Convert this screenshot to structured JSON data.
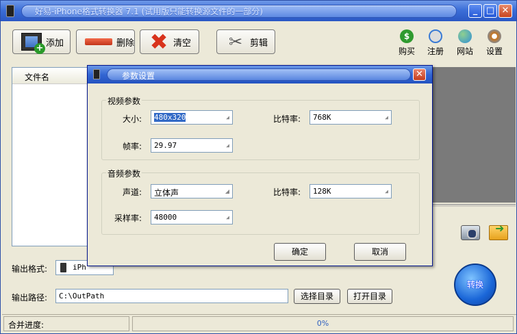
{
  "window": {
    "title": "好易-iPhone格式转换器 7.1 (试用版只能转换源文件的一部分)",
    "min": "_",
    "max": "□",
    "close": "✕"
  },
  "toolbar": {
    "add_label": "添加",
    "delete_label": "删除",
    "clear_label": "清空",
    "cut_label": "剪辑"
  },
  "right_tools": [
    {
      "label": "购买",
      "icon": "dollar-icon",
      "color": "#2f9a2f"
    },
    {
      "label": "注册",
      "icon": "lock-icon",
      "color": "#3a7bd5"
    },
    {
      "label": "网站",
      "icon": "globe-icon",
      "color": "#2f8fd8"
    },
    {
      "label": "设置",
      "icon": "gear-icon",
      "color": "#c8741e"
    }
  ],
  "filelist": {
    "header": "文件名"
  },
  "output": {
    "format_label": "输出格式:",
    "format_value": "iPh",
    "path_label": "输出路径:",
    "path_value": "C:\\OutPath",
    "choose_dir": "选择目录",
    "open_dir": "打开目录"
  },
  "convert_label": "转换",
  "status": {
    "merge_label": "合并进度:",
    "progress_text": "0%",
    "progress": 0
  },
  "dialog": {
    "title": "参数设置",
    "close": "✕",
    "video": {
      "group_label": "视频参数",
      "size_label": "大小:",
      "size_value": "480x320",
      "bitrate_label": "比特率:",
      "bitrate_value": "768K",
      "fps_label": "帧率:",
      "fps_value": "29.97"
    },
    "audio": {
      "group_label": "音频参数",
      "channel_label": "声道:",
      "channel_value": "立体声",
      "bitrate_label": "比特率:",
      "bitrate_value": "128K",
      "samplerate_label": "采样率:",
      "samplerate_value": "48000"
    },
    "ok": "确定",
    "cancel": "取消"
  }
}
